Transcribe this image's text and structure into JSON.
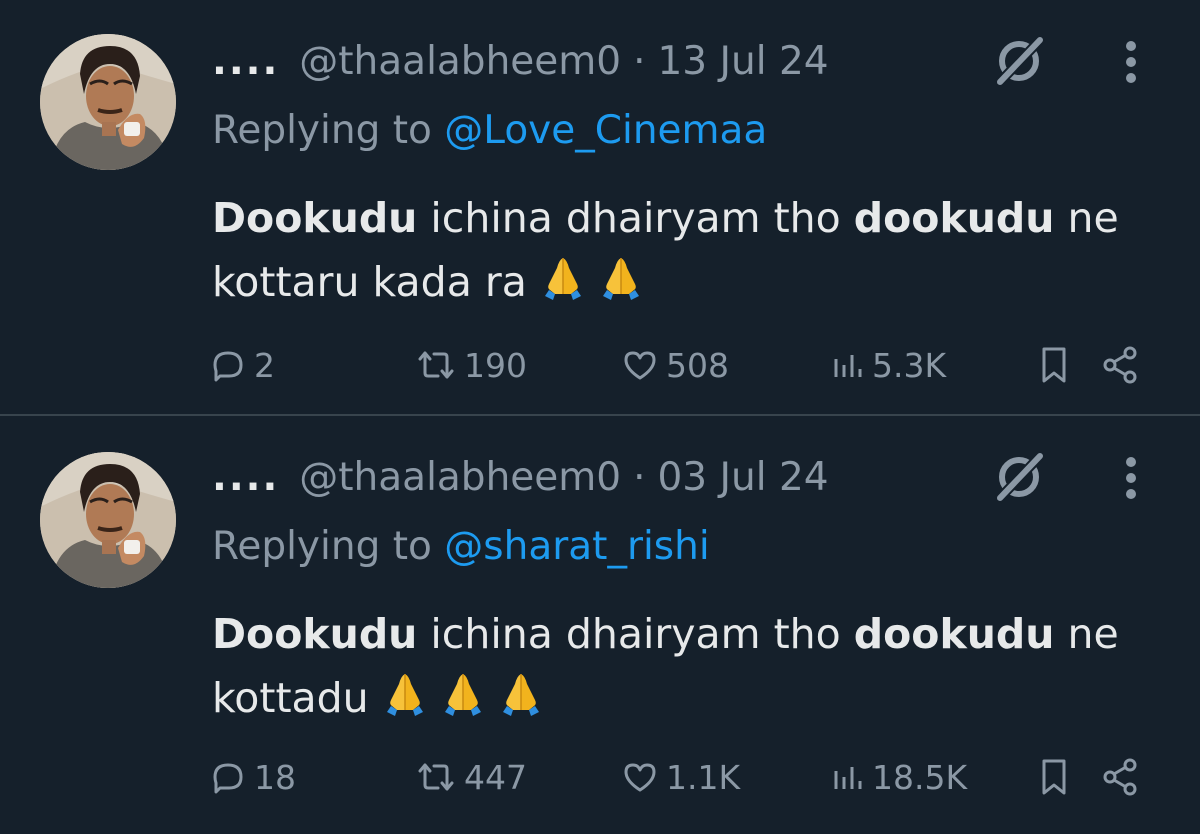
{
  "tweets": [
    {
      "display_name": "....",
      "handle": "@thaalabheem0",
      "separator": "·",
      "date": "13 Jul 24",
      "replying_prefix": "Replying to",
      "replying_handle": "@Love_Cinemaa",
      "body": {
        "bold1": "Dookudu",
        "text1": " ichina dhairyam tho ",
        "bold2": "dookudu",
        "text2": " ne kottaru kada ra",
        "emoji_count": 2,
        "emoji": "folded-hands"
      },
      "stats": {
        "replies": "2",
        "reposts": "190",
        "likes": "508",
        "views": "5.3K"
      }
    },
    {
      "display_name": "....",
      "handle": "@thaalabheem0",
      "separator": "·",
      "date": "03 Jul 24",
      "replying_prefix": "Replying to",
      "replying_handle": "@sharat_rishi",
      "body": {
        "bold1": "Dookudu",
        "text1": " ichina dhairyam tho ",
        "bold2": "dookudu",
        "text2": " ne kottadu",
        "emoji_count": 3,
        "emoji": "folded-hands"
      },
      "stats": {
        "replies": "18",
        "reposts": "447",
        "likes": "1.1K",
        "views": "18.5K"
      }
    }
  ],
  "icons": {
    "reply": "reply-icon",
    "repost": "repost-icon",
    "like": "heart-icon",
    "views": "views-icon",
    "bookmark": "bookmark-icon",
    "share": "share-icon",
    "grok": "grok-icon",
    "more": "more-icon"
  },
  "colors": {
    "background": "#15202b",
    "text_primary": "#e7e9ea",
    "text_secondary": "#8b98a5",
    "link": "#1d9bf0",
    "divider": "#38444d"
  }
}
